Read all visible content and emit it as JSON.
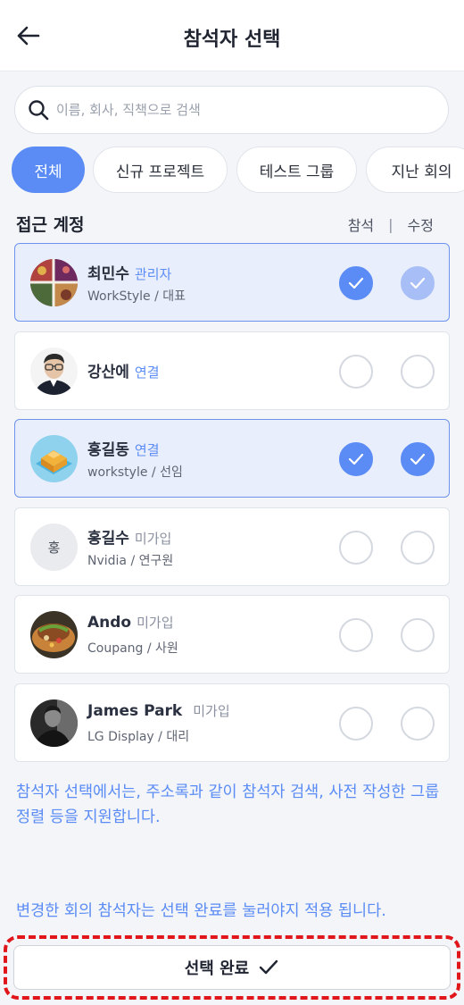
{
  "header": {
    "title": "참석자 선택"
  },
  "search": {
    "placeholder": "이름, 회사, 직책으로 검색"
  },
  "filters": [
    "전체",
    "신규 프로젝트",
    "테스트 그룹",
    "지난 회의"
  ],
  "section": {
    "title": "접근 계정",
    "col_attend": "참석",
    "col_separator": "|",
    "col_edit": "수정"
  },
  "participants": [
    {
      "name": "최민수",
      "status": "관리자",
      "sub": "WorkStyle / 대표",
      "attend": true,
      "edit": true,
      "avatar_icon": "patterned-fabric-photo"
    },
    {
      "name": "강산에",
      "status": "연결",
      "sub": "",
      "attend": false,
      "edit": false,
      "avatar_icon": "man-with-glasses-photo"
    },
    {
      "name": "홍길동",
      "status": "연결",
      "sub": "workstyle / 선임",
      "attend": true,
      "edit": true,
      "avatar_icon": "isometric-building-photo"
    },
    {
      "name": "홍길수",
      "status": "미가입",
      "sub": "Nvidia / 연구원",
      "attend": false,
      "edit": false,
      "avatar_initial": "홍"
    },
    {
      "name": "Ando",
      "status": "미가입",
      "sub": "Coupang / 사원",
      "attend": false,
      "edit": false,
      "avatar_icon": "food-dish-photo"
    },
    {
      "name": "James Park",
      "status": "미가입",
      "sub": "LG Display / 대리",
      "attend": false,
      "edit": false,
      "avatar_icon": "person-dark-photo"
    }
  ],
  "notes": {
    "info": "참석자 선택에서는, 주소록과 같이 참석자 검색, 사전 작성한 그룹 정렬 등을 지원합니다.",
    "apply": "변경한 회의 참석자는 선택 완료를 눌러야지 적용 됩니다."
  },
  "footer": {
    "complete_label": "선택 완료"
  },
  "colors": {
    "accent": "#5b8cf5",
    "selected_bg": "#e9eefc",
    "highlight_border": "#e0161b"
  }
}
